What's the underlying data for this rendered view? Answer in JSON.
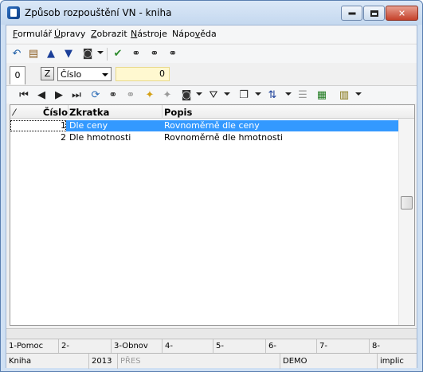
{
  "window": {
    "title": "Způsob rozpouštění VN - kniha"
  },
  "menu": {
    "items": [
      "Formulář",
      "Úpravy",
      "Zobrazit",
      "Nástroje",
      "Nápověda"
    ],
    "underlined": [
      "F",
      "Ú",
      "Z",
      "N",
      "v"
    ]
  },
  "toolbar1": {
    "icons": [
      "undo-icon",
      "book-icon",
      "arrow-up-icon",
      "arrow-down-icon",
      "camera-settings-icon",
      "filter-check-icon",
      "binoculars-icon",
      "binoculars-next-icon",
      "binoculars-settings-icon"
    ]
  },
  "filter": {
    "tab_label": "0",
    "z_label": "Z",
    "sort_field": "Číslo",
    "search_value": "0"
  },
  "toolbar2": {
    "icons": [
      "first-record-icon",
      "prev-record-icon",
      "next-record-icon",
      "last-record-icon",
      "refresh-icon",
      "find-icon",
      "find-next-icon",
      "add-star-icon",
      "remove-icon",
      "camera-settings-icon",
      "filter-icon",
      "copy-icon",
      "sort-az-icon",
      "list-icon",
      "export-excel-icon",
      "columns-icon"
    ]
  },
  "grid": {
    "columns": [
      "Číslo",
      "Zkratka",
      "Popis"
    ],
    "rows": [
      {
        "cislo": "1",
        "zkratka": "Dle ceny",
        "popis": "Rovnoměrně dle ceny",
        "selected": true
      },
      {
        "cislo": "2",
        "zkratka": "Dle hmotnosti",
        "popis": "Rovnoměrně dle hmotnosti",
        "selected": false
      }
    ]
  },
  "fkeys": [
    "1-Pomoc",
    "2-",
    "3-Obnov",
    "4-",
    "5-",
    "6-",
    "7-",
    "8-"
  ],
  "status": {
    "module": "Kniha",
    "year": "2013",
    "pres": "PŘES",
    "database": "DEMO",
    "mode": "implic"
  },
  "colors": {
    "selection": "#3399ff",
    "search_field_bg": "#fff8d0"
  }
}
